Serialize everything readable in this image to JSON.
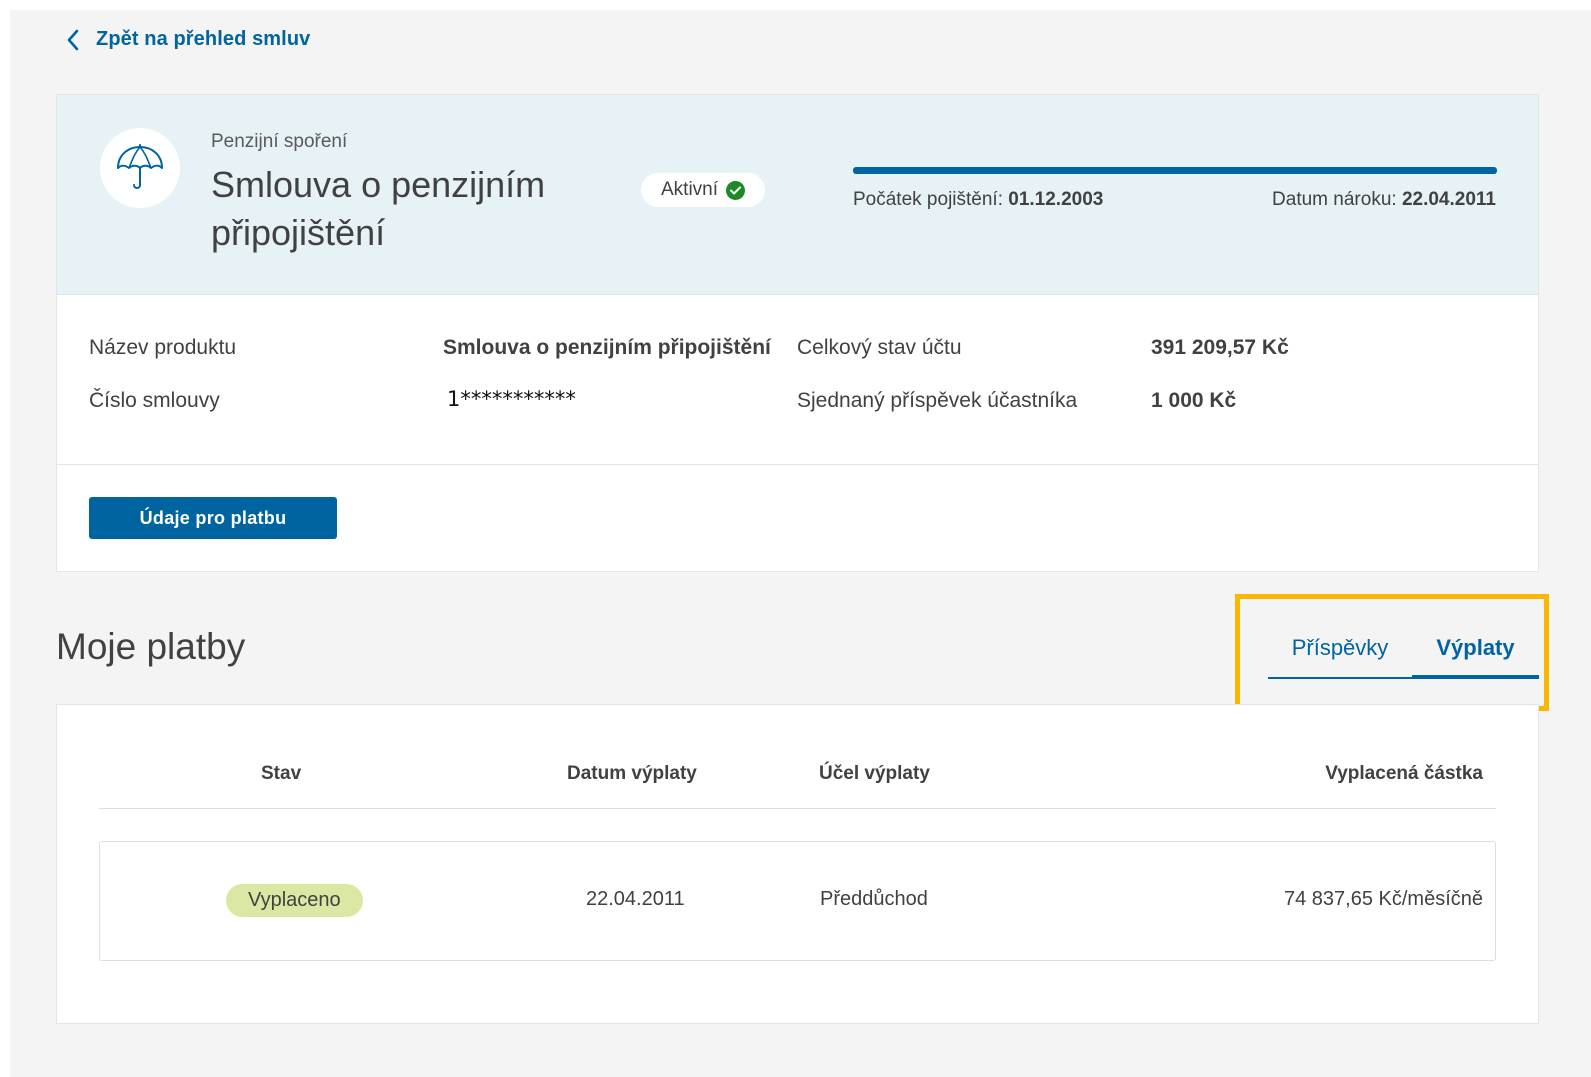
{
  "nav": {
    "back_label": "Zpět na přehled smluv"
  },
  "contract": {
    "category": "Penzijní spoření",
    "title": "Smlouva o penzijním připojištění",
    "status": "Aktivní",
    "progress_fraction": 1.0,
    "start_label": "Počátek pojištění:",
    "start_date": "01.12.2003",
    "claim_label": "Datum nároku:",
    "claim_date": "22.04.2011"
  },
  "details": {
    "product_name_label": "Název produktu",
    "product_name_value": "Smlouva o penzijním připojištění",
    "contract_number_label": "Číslo smlouvy",
    "contract_number_value": "1***********",
    "balance_label": "Celkový stav účtu",
    "balance_value": "391 209,57 Kč",
    "contribution_label": "Sjednaný příspěvek účastníka",
    "contribution_value": "1 000 Kč"
  },
  "payment_button": "Údaje pro platbu",
  "payments": {
    "title": "Moje platby",
    "tabs": [
      {
        "label": "Příspěvky",
        "active": false
      },
      {
        "label": "Výplaty",
        "active": true
      }
    ],
    "highlight_color": "#fab600",
    "columns": [
      "Stav",
      "Datum výplaty",
      "Účel výplaty",
      "Vyplacená částka"
    ],
    "rows": [
      {
        "status": "Vyplaceno",
        "date": "22.04.2011",
        "purpose": "Předdůchod",
        "amount": "74 837,65 Kč/měsíčně"
      }
    ]
  },
  "colors": {
    "primary": "#0064a0",
    "header_bg": "#e6f2f6",
    "success": "#1e8927",
    "paid_badge": "#dbe8a3"
  },
  "icons": {
    "back": "chevron-left-icon",
    "product": "umbrella-icon",
    "status": "check-circle-icon"
  }
}
